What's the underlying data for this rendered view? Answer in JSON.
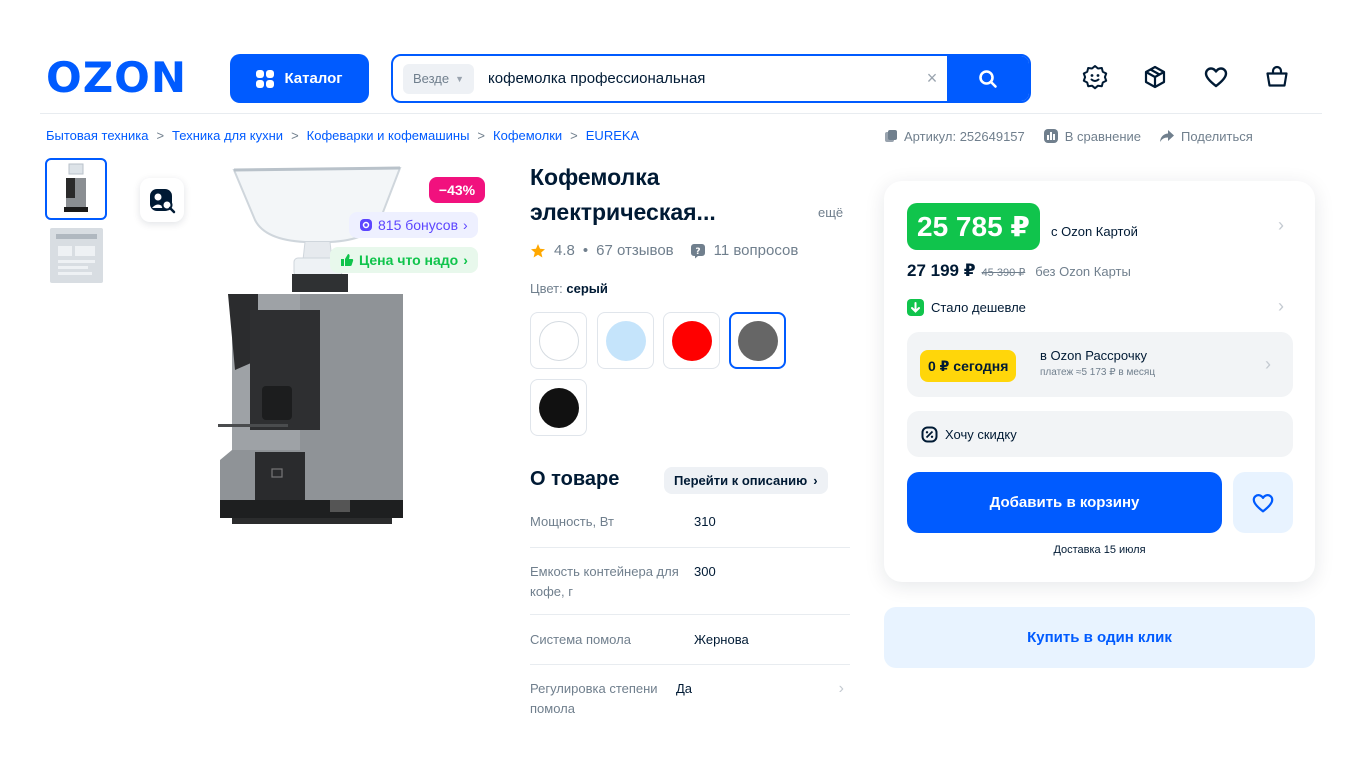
{
  "header": {
    "logo": "OZON",
    "catalog_label": "Каталог",
    "search": {
      "scope": "Везде",
      "query": "кофемолка профессиональная"
    },
    "icons": [
      "smiley-icon",
      "box-icon",
      "heart-icon",
      "bag-icon"
    ]
  },
  "breadcrumbs": [
    "Бытовая техника",
    "Техника для кухни",
    "Кофеварки и кофемашины",
    "Кофемолки",
    "EUREKA"
  ],
  "meta": {
    "article": "Артикул: 252649157",
    "compare": "В сравнение",
    "share": "Поделиться"
  },
  "gallery": {
    "badges": {
      "discount": "−43%",
      "bonus": "815 бонусов",
      "price_tag": "Цена что надо"
    }
  },
  "product": {
    "title_line1": "Кофемолка",
    "title_line2": "электрическая...",
    "more": "ещё",
    "rating": "4.8",
    "reviews": "67 отзывов",
    "questions": "11 вопросов",
    "color_label": "Цвет:",
    "color_value": "серый",
    "swatches": [
      {
        "name": "white",
        "color": "#ffffff"
      },
      {
        "name": "light-blue",
        "color": "#c5e4fb"
      },
      {
        "name": "red",
        "color": "#ff0000"
      },
      {
        "name": "gray",
        "color": "#666666",
        "selected": true
      },
      {
        "name": "black",
        "color": "#111111"
      }
    ]
  },
  "about": {
    "title": "О товаре",
    "goto_label": "Перейти к описанию",
    "specs": [
      {
        "k": "Мощность, Вт",
        "v": "310"
      },
      {
        "k": "Емкость контейнера для кофе, г",
        "v": "300"
      },
      {
        "k": "Система помола",
        "v": "Жернова"
      },
      {
        "k": "Регулировка степени помола",
        "v": "Да"
      }
    ]
  },
  "buy": {
    "card_price": "25 785 ₽",
    "card_note": "с Ozon Картой",
    "base_price": "27 199 ₽",
    "old_price": "45 390 ₽",
    "no_card_note": "без Ozon Карты",
    "cheaper": "Стало дешевле",
    "installment_tag": "0 ₽ сегодня",
    "installment_title": "в Ozon Рассрочку",
    "installment_sub": "платеж ≈5 173 ₽ в месяц",
    "want_discount": "Хочу скидку",
    "add_to_cart": "Добавить в корзину",
    "delivery": "Доставка 15 июля",
    "one_click": "Купить в один клик"
  },
  "colors": {
    "brand": "#005bff",
    "green": "#10c44c",
    "pink": "#f1117e",
    "yellow": "#ffd60a"
  }
}
